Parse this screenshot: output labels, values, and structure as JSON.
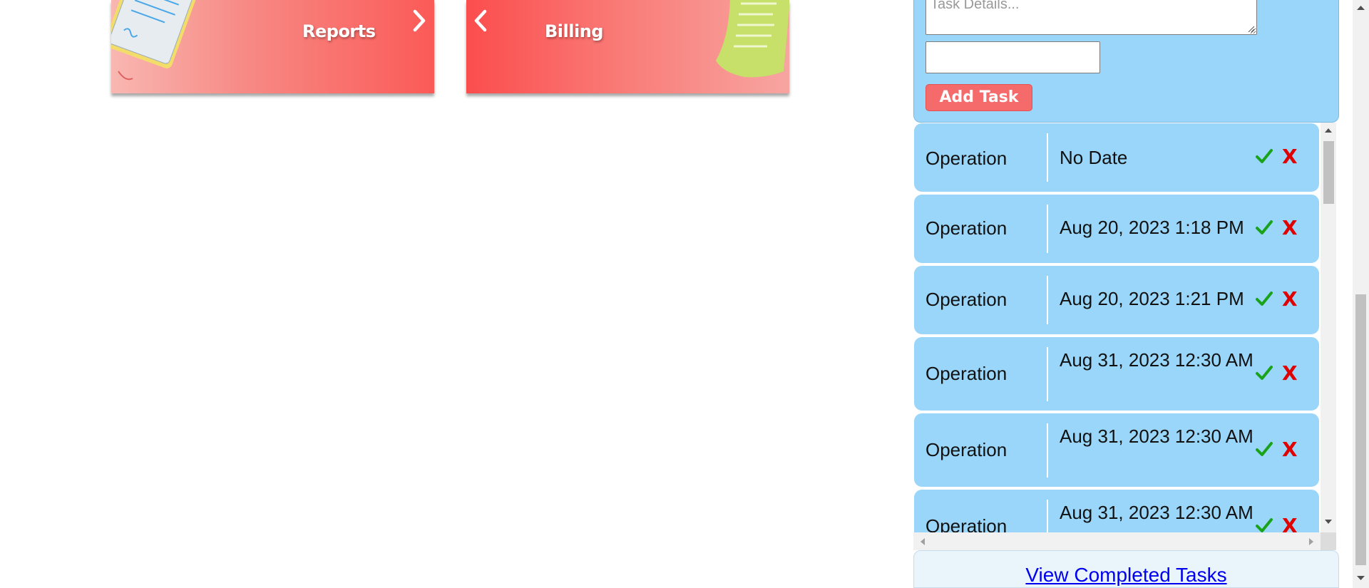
{
  "cards": [
    {
      "label": "Reports",
      "nav": "next"
    },
    {
      "label": "Billing",
      "nav": "prev"
    }
  ],
  "task_form": {
    "details_placeholder": "Task Details...",
    "date_value": "",
    "add_button": "Add Task"
  },
  "tasks": [
    {
      "category": "Operation",
      "date": "No Date"
    },
    {
      "category": "Operation",
      "date": "Aug 20, 2023 1:18 PM"
    },
    {
      "category": "Operation",
      "date": "Aug 20, 2023 1:21 PM"
    },
    {
      "category": "Operation",
      "date": "Aug 31, 2023 12:30 AM"
    },
    {
      "category": "Operation",
      "date": "Aug 31, 2023 12:30 AM"
    },
    {
      "category": "Operation",
      "date": "Aug 31, 2023 12:30 AM"
    }
  ],
  "footer": {
    "link": "View Completed Tasks"
  },
  "colors": {
    "accent": "#f56b6b",
    "panel": "#99d6fa",
    "check": "#1aa31a",
    "delete": "#e00000",
    "link": "#0000ee"
  }
}
